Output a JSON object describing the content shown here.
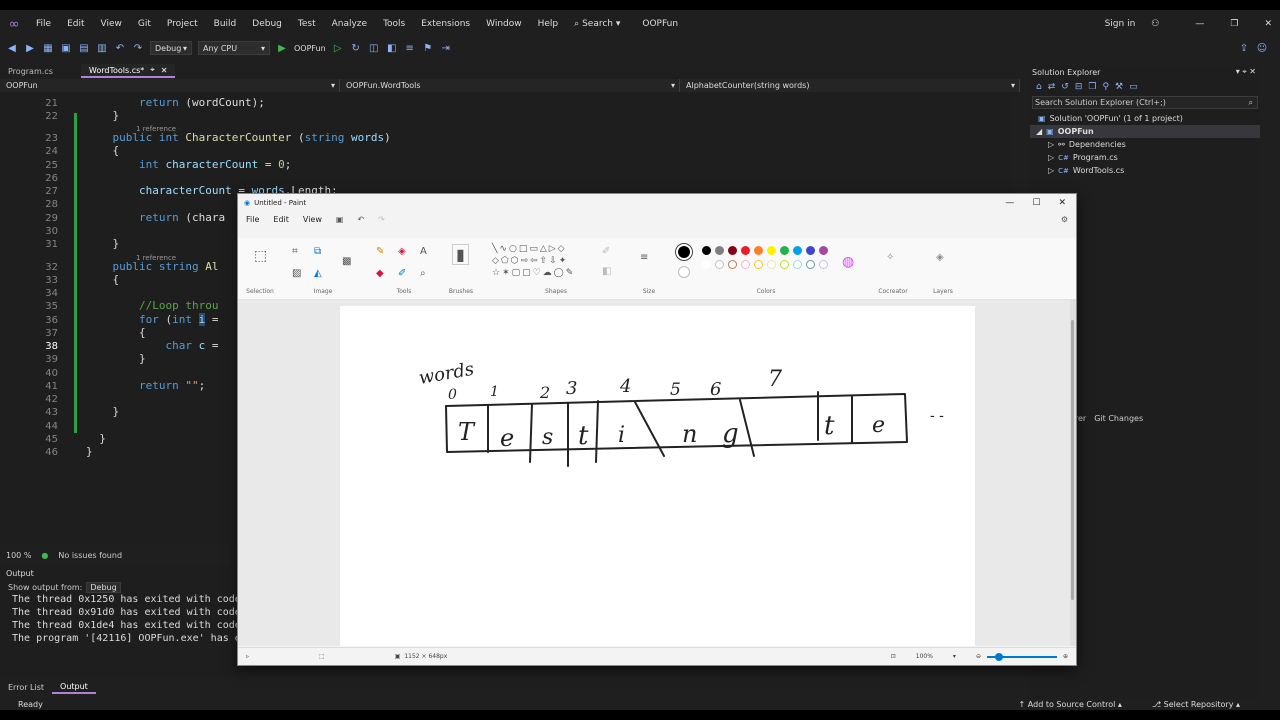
{
  "menu": [
    "File",
    "Edit",
    "View",
    "Git",
    "Project",
    "Build",
    "Debug",
    "Test",
    "Analyze",
    "Tools",
    "Extensions",
    "Window",
    "Help"
  ],
  "search_label": "Search",
  "app_title": "OOPFun",
  "sign_in": "Sign in",
  "toolbar": {
    "config": "Debug",
    "platform": "Any CPU",
    "run_label": "OOPFun"
  },
  "tabs": [
    {
      "label": "Program.cs"
    },
    {
      "label": "WordTools.cs*"
    }
  ],
  "navbar": {
    "project": "OOPFun",
    "class": "OOPFun.WordTools",
    "member": "AlphabetCounter(string words)"
  },
  "code": {
    "line_numbers": [
      "21",
      "22",
      "23",
      "24",
      "25",
      "26",
      "27",
      "28",
      "29",
      "30",
      "31",
      "32",
      "33",
      "34",
      "35",
      "36",
      "37",
      "38",
      "39",
      "40",
      "41",
      "42",
      "43",
      "44",
      "45",
      "46"
    ],
    "ref_label": "1 reference"
  },
  "editor_status": {
    "zoom": "100 %",
    "issues": "No issues found"
  },
  "output": {
    "title": "Output",
    "show_from_label": "Show output from:",
    "source": "Debug",
    "lines": [
      "The thread 0x1250 has exited with code",
      "The thread 0x91d0 has exited with code",
      "The thread 0x1de4 has exited with code",
      "The program '[42116] OOPFun.exe' has e"
    ]
  },
  "bottom_tabs": [
    "Error List",
    "Output"
  ],
  "statusbar": {
    "ready": "Ready",
    "add_source": "Add to Source Control",
    "select_repo": "Select Repository"
  },
  "solution": {
    "title": "Solution Explorer",
    "search_placeholder": "Search Solution Explorer (Ctrl+;)",
    "items": [
      {
        "label": "Solution 'OOPFun' (1 of 1 project)"
      },
      {
        "label": "OOPFun"
      },
      {
        "label": "Dependencies"
      },
      {
        "label": "Program.cs"
      },
      {
        "label": "WordTools.cs"
      }
    ],
    "lower_tabs": [
      "orer",
      "Git Changes"
    ]
  },
  "paint": {
    "title": "Untitled - Paint",
    "menu": [
      "File",
      "Edit",
      "View"
    ],
    "groups": [
      "Selection",
      "Image",
      "Tools",
      "Brushes",
      "Shapes",
      "Size",
      "Colors",
      "Cocreator",
      "Layers"
    ],
    "canvas_size": "1152 × 648px",
    "zoom": "100%",
    "drawing": {
      "label": "words",
      "indices": [
        "0",
        "1",
        "2",
        "3",
        "4",
        "5",
        "6",
        "7"
      ],
      "letters": [
        "T",
        "e",
        "s",
        "t",
        "i",
        "n",
        "g",
        "t",
        "e"
      ],
      "ellipsis": "- -"
    },
    "colors_row1": [
      "#000000",
      "#7f7f7f",
      "#880015",
      "#ed1c24",
      "#ff7f27",
      "#fff200",
      "#22b14c",
      "#00a2e8",
      "#3f48cc",
      "#a349a4"
    ],
    "colors_row2": [
      "#ffffff",
      "#c3c3c3",
      "#b97a57",
      "#ffaec9",
      "#ffc90e",
      "#efe4b0",
      "#b5e61d",
      "#99d9ea",
      "#7092be",
      "#c8bfe7"
    ]
  }
}
